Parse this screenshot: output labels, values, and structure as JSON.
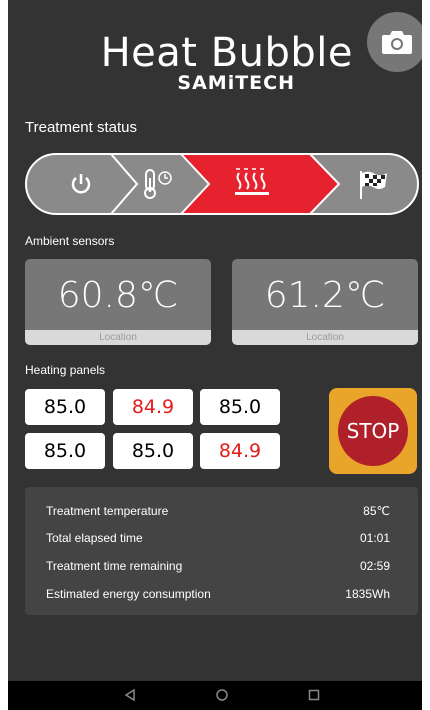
{
  "header": {
    "title": "Heat Bubble",
    "subtitle": "SAMiTECH"
  },
  "treatment_status": {
    "label": "Treatment status",
    "steps": [
      "power",
      "thermometer-timer",
      "heating",
      "finish-flag"
    ],
    "active_step": "heating",
    "active_color": "#e5222e"
  },
  "ambient": {
    "label": "Ambient sensors",
    "sensors": [
      {
        "value": "60.8℃",
        "location": "Location"
      },
      {
        "value": "61.2℃",
        "location": "Location"
      }
    ]
  },
  "panels": {
    "label": "Heating panels",
    "values": [
      "85.0",
      "84.9",
      "85.0",
      "85.0",
      "85.0",
      "84.9"
    ],
    "hot_color": "#e31b1b"
  },
  "stop": {
    "label": "STOP"
  },
  "info": {
    "rows": [
      {
        "label": "Treatment temperature",
        "value": "85℃"
      },
      {
        "label": "Total elapsed time",
        "value": "01:01"
      },
      {
        "label": "Treatment time remaining",
        "value": "02:59"
      },
      {
        "label": "Estimated energy consumption",
        "value": "1835Wh"
      }
    ]
  },
  "colors": {
    "background": "#333333",
    "stop_ring": "#e8a52a",
    "stop_button": "#b0202a"
  }
}
